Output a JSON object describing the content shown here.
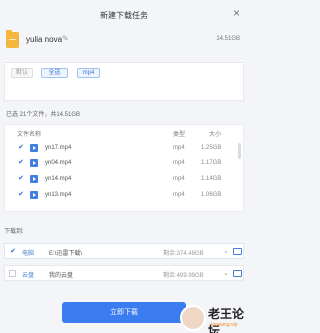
{
  "window": {
    "title": "新建下载任务"
  },
  "task": {
    "name": "yulia nova",
    "size": "14.51GB"
  },
  "filters": {
    "default": "默认",
    "all": "全选",
    "mp4": "mp4"
  },
  "selection": {
    "summary": "已选 21个文件，共14.51GB"
  },
  "list": {
    "headers": {
      "name": "文件名称",
      "type": "类型",
      "size": "大小"
    },
    "rows": [
      {
        "name": "yn17.mp4",
        "type": "mp4",
        "size": "1.25GB"
      },
      {
        "name": "yn04.mp4",
        "type": "mp4",
        "size": "1.17GB"
      },
      {
        "name": "yn14.mp4",
        "type": "mp4",
        "size": "1.14GB"
      },
      {
        "name": "yn13.mp4",
        "type": "mp4",
        "size": "1.06GB"
      }
    ]
  },
  "download": {
    "label": "下载到:",
    "options": [
      {
        "kind": "电脑",
        "path": "E:\\迅雷下载\\",
        "free": "剩余:374.48GB"
      },
      {
        "kind": "云盘",
        "path": "我的云盘",
        "free": "剩余:499.99GB"
      }
    ]
  },
  "actions": {
    "download_now": "立即下载"
  },
  "watermark": {
    "text": "老王论坛",
    "sub": "laowang.vip"
  }
}
